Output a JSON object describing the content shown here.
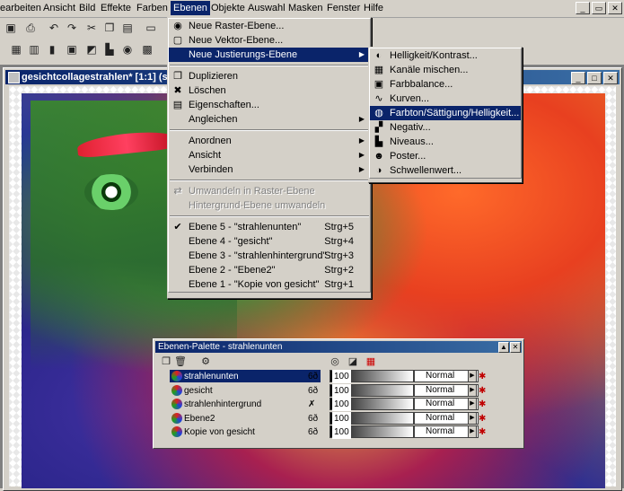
{
  "menubar": {
    "items": [
      "earbeiten",
      "Ansicht",
      "Bild",
      "Effekte",
      "Farben",
      "Ebenen",
      "Objekte",
      "Auswahl",
      "Masken",
      "Fenster",
      "Hilfe"
    ],
    "open_item": "Ebenen"
  },
  "document": {
    "title": "gesichtcollagestrahlen* [1:1] (stra"
  },
  "menu_ebenen": {
    "items": [
      {
        "label": "Neue Raster-Ebene...",
        "icon": "raster-layer-icon"
      },
      {
        "label": "Neue Vektor-Ebene...",
        "icon": "vector-layer-icon"
      },
      {
        "label": "Neue Justierungs-Ebene",
        "submenu": true,
        "selected": true
      },
      {
        "separator": true
      },
      {
        "label": "Duplizieren",
        "icon": "duplicate-icon"
      },
      {
        "label": "Löschen",
        "icon": "delete-icon"
      },
      {
        "label": "Eigenschaften...",
        "icon": "properties-icon"
      },
      {
        "label": "Angleichen",
        "submenu": true
      },
      {
        "separator": true
      },
      {
        "label": "Anordnen",
        "submenu": true
      },
      {
        "label": "Ansicht",
        "submenu": true
      },
      {
        "label": "Verbinden",
        "submenu": true
      },
      {
        "separator": true
      },
      {
        "label": "Umwandeln in Raster-Ebene",
        "disabled": true,
        "icon": "convert-icon"
      },
      {
        "label": "Hintergrund-Ebene umwandeln",
        "disabled": true
      },
      {
        "separator": true
      },
      {
        "label": "Ebene 5 - \"strahlenunten\"",
        "shortcut": "Strg+5",
        "checked": true
      },
      {
        "label": "Ebene 4 - \"gesicht\"",
        "shortcut": "Strg+4"
      },
      {
        "label": "Ebene 3 - \"strahlenhintergrund\"",
        "shortcut": "Strg+3"
      },
      {
        "label": "Ebene 2 - \"Ebene2\"",
        "shortcut": "Strg+2"
      },
      {
        "label": "Ebene 1 - \"Kopie von gesicht\"",
        "shortcut": "Strg+1"
      }
    ]
  },
  "submenu_justierung": {
    "items": [
      {
        "label": "Helligkeit/Kontrast...",
        "icon": "brightness-icon"
      },
      {
        "label": "Kanäle mischen...",
        "icon": "channel-mixer-icon"
      },
      {
        "label": "Farbbalance...",
        "icon": "color-balance-icon"
      },
      {
        "label": "Kurven...",
        "icon": "curves-icon"
      },
      {
        "label": "Farbton/Sättigung/Helligkeit...",
        "icon": "hue-saturation-icon",
        "selected": true
      },
      {
        "label": "Negativ...",
        "icon": "negative-icon"
      },
      {
        "label": "Niveaus...",
        "icon": "levels-icon"
      },
      {
        "label": "Poster...",
        "icon": "poster-icon"
      },
      {
        "label": "Schwellenwert...",
        "icon": "threshold-icon"
      }
    ]
  },
  "layer_palette": {
    "title": "Ebenen-Palette - strahlenunten",
    "layers": [
      {
        "name": "strahlenunten",
        "opacity": "100",
        "blend": "Normal",
        "selected": true,
        "visible": "6ð"
      },
      {
        "name": "gesicht",
        "opacity": "100",
        "blend": "Normal",
        "visible": "6ð"
      },
      {
        "name": "strahlenhintergrund",
        "opacity": "100",
        "blend": "Normal",
        "visible": "✗"
      },
      {
        "name": "Ebene2",
        "opacity": "100",
        "blend": "Normal",
        "visible": "6ð"
      },
      {
        "name": "Kopie von gesicht",
        "opacity": "100",
        "blend": "Normal",
        "visible": "6ð"
      }
    ]
  },
  "colors": {
    "selection": "#0a246a",
    "face": "#d4d0c8"
  }
}
